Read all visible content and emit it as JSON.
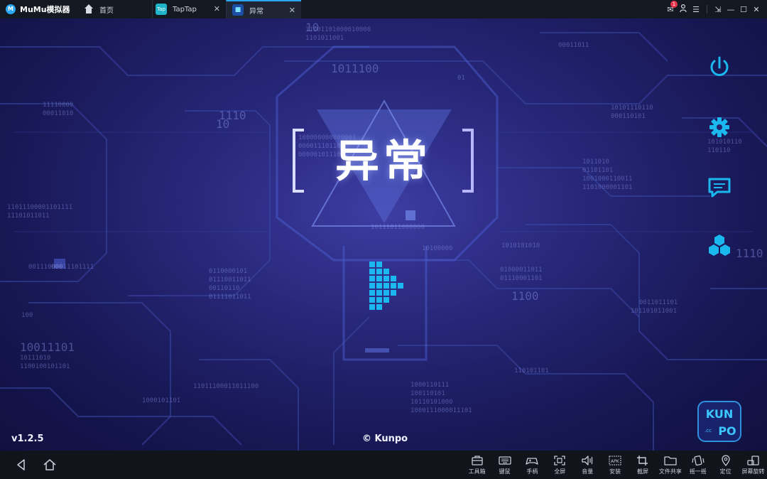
{
  "titlebar": {
    "app_name": "MuMu模拟器",
    "logo_glyph": "M",
    "tabs": [
      {
        "label": "首页",
        "icon": "home-icon"
      },
      {
        "label": "TapTap",
        "icon": "taptap-icon",
        "icon_text": "Tap",
        "close": "✕"
      },
      {
        "label": "异常",
        "icon": "game-icon",
        "icon_text": "■",
        "close": "✕",
        "active": true
      }
    ],
    "notification_count": "1",
    "controls": {
      "mail": "✉",
      "user": "👤",
      "menu": "☰",
      "pin": "⇲",
      "minimize": "—",
      "maximize": "☐",
      "close": "✕"
    }
  },
  "game": {
    "title": "异常",
    "version": "v1.2.5",
    "copyright": "© Kunpo",
    "brand_logo": "KUN PO .cc",
    "accent": "#1ab8ee",
    "binary_strings": [
      "11001101000010000",
      "1011100",
      "01",
      "1110",
      "11110000",
      "00011010",
      "11011100001101111",
      "11101011011",
      "00111000011101111",
      "000",
      "100",
      "1100",
      "10011101",
      "10111010",
      "1011010",
      "01101101",
      "10100000",
      "0110000101",
      "01110011011",
      "00110110",
      "01111011011",
      "01000011011",
      "1010101010",
      "0011011101",
      "101101011001",
      "110101101",
      "1000110111",
      "100110101",
      "10110101000",
      "1000111000011101",
      "11011100011011100",
      "10111011000000",
      "00011011",
      "10101110110",
      "000110101",
      "100000000000001",
      "000011101101",
      "000001011101",
      "101010110",
      "110110",
      "1001000110011",
      "1101000001101",
      "01110001101",
      "1101011001",
      "1100100101101",
      "1000101101",
      "10",
      "1110",
      "10"
    ]
  },
  "bottombar": {
    "nav": [
      {
        "name": "back-button",
        "icon": "back-icon"
      },
      {
        "name": "home-button",
        "icon": "home-icon"
      }
    ],
    "tools": [
      {
        "label": "工具箱",
        "icon": "toolbox-icon"
      },
      {
        "label": "键鼠",
        "icon": "keyboard-icon"
      },
      {
        "label": "手柄",
        "icon": "gamepad-icon"
      },
      {
        "label": "全屏",
        "icon": "fullscreen-icon"
      },
      {
        "label": "音量",
        "icon": "volume-icon"
      },
      {
        "label": "安装",
        "icon": "apk-icon",
        "icon_text": "APK"
      },
      {
        "label": "截屏",
        "icon": "crop-icon"
      },
      {
        "label": "文件共享",
        "icon": "folder-icon"
      },
      {
        "label": "摇一摇",
        "icon": "shake-icon"
      },
      {
        "label": "定位",
        "icon": "location-icon"
      },
      {
        "label": "屏幕旋转",
        "icon": "rotate-icon"
      }
    ]
  }
}
